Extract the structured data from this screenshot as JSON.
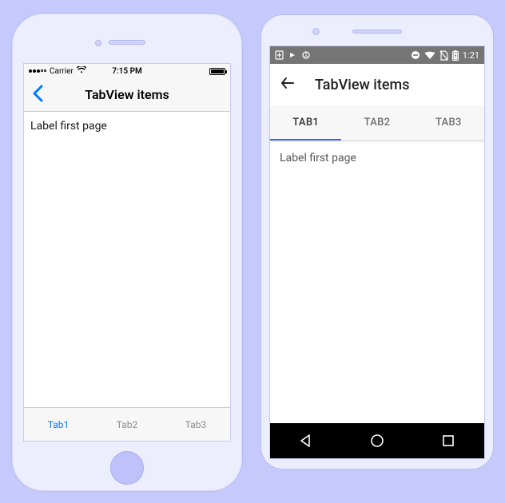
{
  "ios": {
    "status": {
      "carrier": "Carrier",
      "wifi_icon": "wifi",
      "time": "7:15 PM"
    },
    "nav": {
      "back_icon": "chevron-left",
      "title": "TabView items"
    },
    "content_label": "Label first page",
    "tabs": [
      {
        "label": "Tab1",
        "active": true
      },
      {
        "label": "Tab2",
        "active": false
      },
      {
        "label": "Tab3",
        "active": false
      }
    ]
  },
  "android": {
    "status": {
      "time": "1:21"
    },
    "nav": {
      "back_icon": "arrow-left",
      "title": "TabView items"
    },
    "tabs": [
      {
        "label": "TAB1",
        "active": true
      },
      {
        "label": "TAB2",
        "active": false
      },
      {
        "label": "TAB3",
        "active": false
      }
    ],
    "content_label": "Label first page"
  }
}
